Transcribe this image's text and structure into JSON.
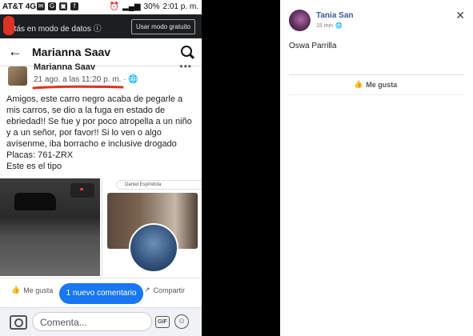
{
  "status_bar": {
    "carrier": "AT&T 4G",
    "battery": "30%",
    "time": "2:01 p. m."
  },
  "data_bar": {
    "text": "Estás en modo de datos",
    "button": "Usar modo gratuito"
  },
  "header": {
    "title": "Marianna Saav"
  },
  "post": {
    "author": "Marianna Saav",
    "time": "21 ago. a las 11:20 p. m. ·",
    "lines": [
      "Amigos, este carro negro acaba de pegarle a",
      "mis carros, se dio a la fuga en estado de",
      "ebriedad!! Se fue y por poco atropella a un niño",
      "y a un señor, por favor!! Si lo ven o algo",
      "avísenme, iba borracho e inclusive drogado",
      "Placas: 761-ZRX",
      "Este es el tipo"
    ],
    "photo2_search": "Daniel Espíndola"
  },
  "actions": {
    "like": "Me gusta",
    "share": "Compartir",
    "new_comments": "1 nuevo comentario"
  },
  "composer": {
    "placeholder": "Comenta...",
    "gif": "GIF"
  },
  "comment_card": {
    "author": "Tania San",
    "time": "15 min",
    "text": "Oswa Parrilla",
    "like": "Me gusta"
  },
  "colors": {
    "facebook_blue": "#1877f2",
    "name_blue": "#385898",
    "red_mark": "#dd3322"
  },
  "icons": [
    "back-arrow-icon",
    "search-icon",
    "camera-icon",
    "gif-icon",
    "emoji-icon",
    "thumbs-up-icon",
    "share-icon",
    "close-icon",
    "globe-icon",
    "help-icon"
  ]
}
